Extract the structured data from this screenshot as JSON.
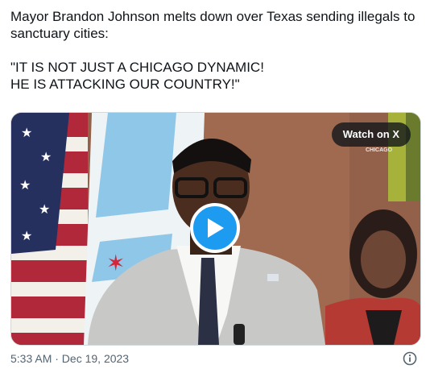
{
  "tweet": {
    "text": "Mayor Brandon Johnson melts down over Texas sending illegals to sanctuary cities:\n\n\"IT IS NOT JUST A CHICAGO DYNAMIC!\nHE IS ATTACKING OUR COUNTRY!\"",
    "timestamp": "5:33 AM · Dec 19, 2023"
  },
  "media": {
    "watch_label": "Watch on X",
    "overlay_caption": "CHICAGO",
    "play_icon": "play-icon"
  },
  "icons": {
    "info": "info-icon"
  },
  "colors": {
    "accent": "#1d9bf0",
    "secondary_text": "#536471"
  }
}
